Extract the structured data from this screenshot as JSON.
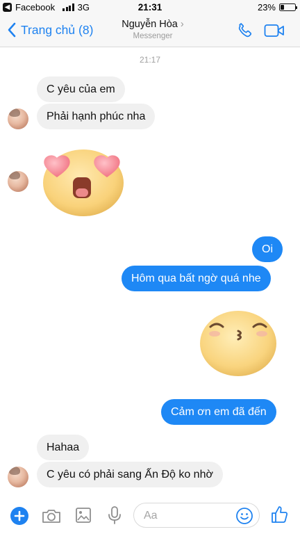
{
  "status_bar": {
    "back_app": "Facebook",
    "network": "3G",
    "time": "21:31",
    "battery_text": "23%",
    "battery_level": 0.23
  },
  "navbar": {
    "back_label": "Trang chủ (8)",
    "contact_name": "Nguyễn Hòa",
    "chevron": "›",
    "subtitle": "Messenger",
    "call_icon": "phone-icon",
    "video_icon": "video-camera-icon"
  },
  "conversation": {
    "timestamp": "21:17",
    "messages": [
      {
        "from": "them",
        "type": "text",
        "text": "C yêu của em"
      },
      {
        "from": "them",
        "type": "text",
        "text": "Phải hạnh phúc nha"
      },
      {
        "from": "them",
        "type": "sticker",
        "sticker": "heart-eyes-emoji-sticker"
      },
      {
        "from": "me",
        "type": "text",
        "text": "Oi"
      },
      {
        "from": "me",
        "type": "text",
        "text": "Hôm qua bất ngờ quá nhe"
      },
      {
        "from": "me",
        "type": "sticker",
        "sticker": "kissing-emoji-sticker"
      },
      {
        "from": "me",
        "type": "text",
        "text": "Cảm ơn em đã đến"
      },
      {
        "from": "them",
        "type": "text",
        "text": "Hahaa"
      },
      {
        "from": "them",
        "type": "text",
        "text": "C yêu có phải sang Ấn Độ ko nhờ"
      }
    ]
  },
  "composer": {
    "placeholder": "Aa",
    "icons": [
      "plus-icon",
      "camera-icon",
      "image-icon",
      "microphone-icon",
      "emoji-icon",
      "thumbs-up-icon"
    ]
  },
  "colors": {
    "accent": "#1e88f5",
    "incoming_bubble": "#f0f0f0",
    "navbar_bg": "#f7f7f7"
  }
}
